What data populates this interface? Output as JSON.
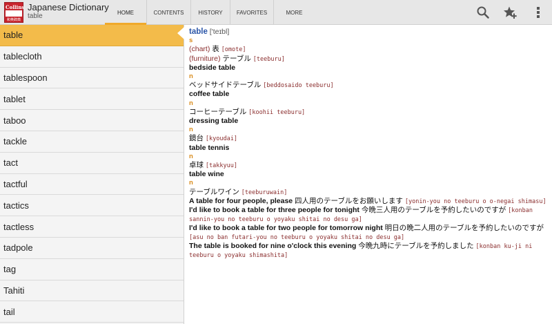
{
  "app": {
    "title": "Japanese Dictionary",
    "subtitle": "table",
    "icon_top": "Collins",
    "icon_bottom": "和英辞典"
  },
  "tabs": [
    {
      "label": "HOME"
    },
    {
      "label": "CONTENTS"
    },
    {
      "label": "HISTORY"
    },
    {
      "label": "FAVORITES"
    },
    {
      "label": "MORE"
    }
  ],
  "actions": {
    "search_icon": "search-icon",
    "favorite_icon": "star-plus-icon",
    "overflow_icon": "overflow-menu-icon"
  },
  "colors": {
    "accent": "#f0a92b",
    "selected_row": "#f3bb4a",
    "headword": "#2b56a8",
    "pos": "#d98b1a",
    "romaji": "#8a2d2d"
  },
  "wordlist": [
    "table",
    "tablecloth",
    "tablespoon",
    "tablet",
    "taboo",
    "tackle",
    "tact",
    "tactful",
    "tactics",
    "tactless",
    "tadpole",
    "tag",
    "Tahiti",
    "tail"
  ],
  "entry": {
    "headword": "table",
    "pron": "['teɪbl]",
    "s1_pos": "s",
    "s1_open1": "(",
    "s1_gloss1": "chart",
    "s1_close1": ")",
    "s1_jp1": " 表 ",
    "s1_rom1": "[omote]",
    "s1_open2": "(",
    "s1_gloss2": "furniture",
    "s1_close2": ")",
    "s1_jp2": " テーブル ",
    "s1_rom2": "[teeburu]",
    "c1": "bedside table",
    "c1_pos": "n",
    "c1_jp": "ベッドサイドテーブル ",
    "c1_rom": "[beddosaido teeburu]",
    "c2": "coffee table",
    "c2_pos": "n",
    "c2_jp": "コーヒーテーブル ",
    "c2_rom": "[koohii teeburu]",
    "c3": "dressing table",
    "c3_pos": "n",
    "c3_jp": "鏡台 ",
    "c3_rom": "[kyoudai]",
    "c4": "table tennis",
    "c4_pos": "n",
    "c4_jp": "卓球 ",
    "c4_rom": "[takkyuu]",
    "c5": "table wine",
    "c5_pos": "n",
    "c5_jp": "テーブルワイン ",
    "c5_rom": "[teeburuwain]",
    "e1_en": "A table for four people, please",
    "e1_jp": " 四人用のテーブルをお願いします ",
    "e1_rom": "[yonin-you no teeburu o o-negai shimasu]",
    "e2_en": "I'd like to book a table for three people for tonight",
    "e2_jp": " 今晩三人用のテーブルを予約したいのですが ",
    "e2_rom": "[konban sannin-you no teeburu o yoyaku shitai no desu ga]",
    "e3_en": "I'd like to book a table for two people for tomorrow night",
    "e3_jp": " 明日の晩二人用のテーブルを予約したいのですが ",
    "e3_rom": "[asu no ban futari-you no teeburu o yoyaku shitai no desu ga]",
    "e4_en": "The table is booked for nine o'clock this evening",
    "e4_jp": " 今晩九時にテーブルを予約しました ",
    "e4_rom": "[konban ku-ji ni teeburu o yoyaku shimashita]"
  }
}
